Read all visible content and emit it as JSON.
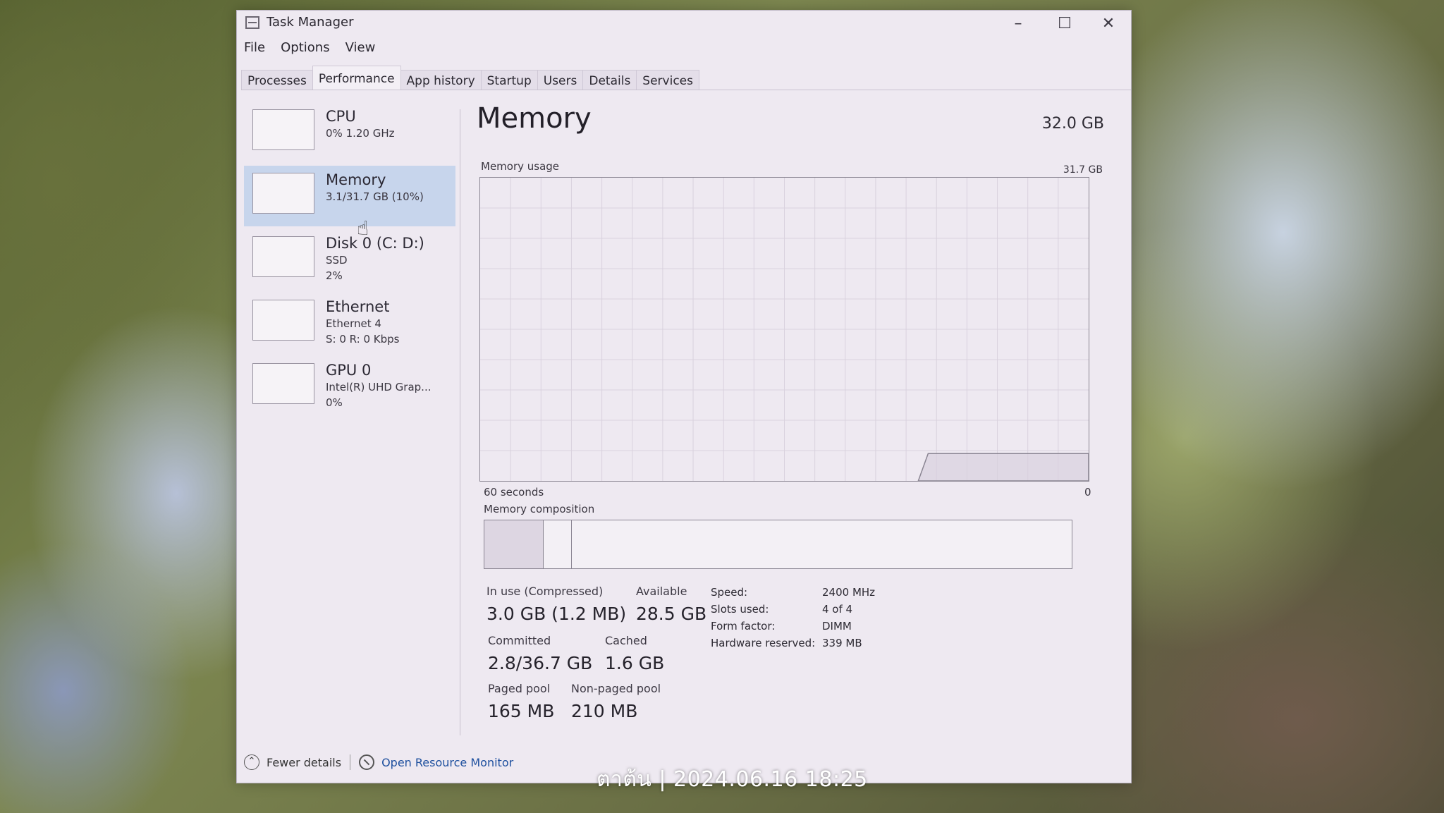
{
  "window": {
    "title": "Task Manager",
    "controls": {
      "minimize": "–",
      "maximize": "☐",
      "close": "✕"
    }
  },
  "menu": [
    "File",
    "Options",
    "View"
  ],
  "tabs": [
    "Processes",
    "Performance",
    "App history",
    "Startup",
    "Users",
    "Details",
    "Services"
  ],
  "active_tab": "Performance",
  "sidebar": {
    "items": [
      {
        "title": "CPU",
        "lines": [
          "0% 1.20 GHz"
        ]
      },
      {
        "title": "Memory",
        "lines": [
          "3.1/31.7 GB (10%)"
        ]
      },
      {
        "title": "Disk 0 (C: D:)",
        "lines": [
          "SSD",
          "2%"
        ]
      },
      {
        "title": "Ethernet",
        "lines": [
          "Ethernet 4",
          "S: 0 R: 0 Kbps"
        ]
      },
      {
        "title": "GPU 0",
        "lines": [
          "Intel(R) UHD Grap...",
          "0%"
        ]
      }
    ],
    "selected_index": 1
  },
  "main": {
    "title": "Memory",
    "total": "32.0 GB",
    "usage_label": "Memory usage",
    "usage_max": "31.7 GB",
    "time_left": "60 seconds",
    "time_right": "0",
    "composition_label": "Memory composition",
    "composition": {
      "in_use_fraction": 0.1,
      "modified_fraction": 0.048
    },
    "stats": {
      "in_use_label": "In use (Compressed)",
      "in_use_value": "3.0 GB (1.2 MB)",
      "available_label": "Available",
      "available_value": "28.5 GB",
      "committed_label": "Committed",
      "committed_value": "2.8/36.7 GB",
      "cached_label": "Cached",
      "cached_value": "1.6 GB",
      "paged_label": "Paged pool",
      "paged_value": "165 MB",
      "nonpaged_label": "Non-paged pool",
      "nonpaged_value": "210 MB"
    },
    "specs": [
      {
        "key": "Speed:",
        "value": "2400 MHz"
      },
      {
        "key": "Slots used:",
        "value": "4 of 4"
      },
      {
        "key": "Form factor:",
        "value": "DIMM"
      },
      {
        "key": "Hardware reserved:",
        "value": "339 MB"
      }
    ],
    "usage_fraction": 0.1
  },
  "footer": {
    "fewer_details": "Fewer details",
    "resource_monitor": "Open Resource Monitor"
  },
  "overlay_text": "ตาต้น | 2024.06.16 18:25",
  "colors": {
    "selected_bg": "#c7d5ec",
    "link": "#1d4f9e",
    "grid": "#d9d2de"
  }
}
